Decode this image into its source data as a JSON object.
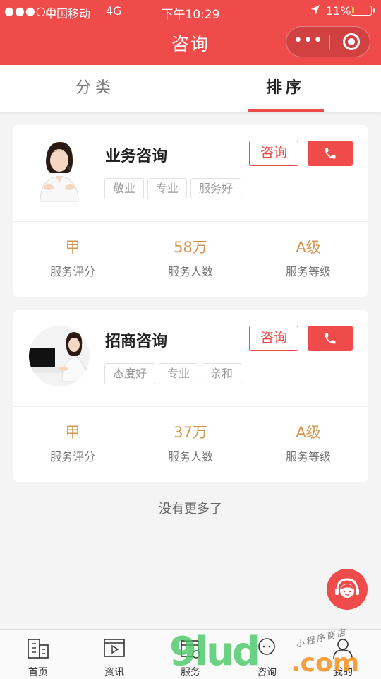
{
  "status_bar": {
    "signal": "●●●○○",
    "carrier": "中国移动",
    "network": "4G",
    "time": "下午10:29",
    "battery_percent": "11%",
    "battery_level": 0.11,
    "location_icon": "location-arrow-icon"
  },
  "nav": {
    "title": "咨询",
    "more_icon": "more-dots-icon",
    "close_icon": "target-circle-icon"
  },
  "tabs": [
    {
      "label": "分类",
      "active": false
    },
    {
      "label": "排序",
      "active": true
    }
  ],
  "cards": [
    {
      "name": "业务咨询",
      "consult_label": "咨询",
      "phone_icon": "phone-icon",
      "tags": [
        "敬业",
        "专业",
        "服务好"
      ],
      "stats": [
        {
          "value": "甲",
          "label": "服务评分"
        },
        {
          "value": "58万",
          "label": "服务人数"
        },
        {
          "value": "A级",
          "label": "服务等级"
        }
      ]
    },
    {
      "name": "招商咨询",
      "consult_label": "咨询",
      "phone_icon": "phone-icon",
      "tags": [
        "态度好",
        "专业",
        "亲和"
      ],
      "stats": [
        {
          "value": "甲",
          "label": "服务评分"
        },
        {
          "value": "37万",
          "label": "服务人数"
        },
        {
          "value": "A级",
          "label": "服务等级"
        }
      ]
    }
  ],
  "no_more": "没有更多了",
  "fab_icon": "customer-service-icon",
  "tabbar": [
    {
      "label": "首页",
      "icon": "building-icon"
    },
    {
      "label": "资讯",
      "icon": "video-icon"
    },
    {
      "label": "服务",
      "icon": "calendar-icon"
    },
    {
      "label": "咨询",
      "icon": "chat-icon"
    },
    {
      "label": "我的",
      "icon": "user-icon"
    }
  ],
  "watermark": {
    "brand": "9lud",
    "domain": ".com",
    "tagline": "小程序商店"
  },
  "colors": {
    "accent": "#f04b4b",
    "stat_value": "#d4974f",
    "tag_text": "#999999",
    "battery_fill": "#f5c542"
  }
}
